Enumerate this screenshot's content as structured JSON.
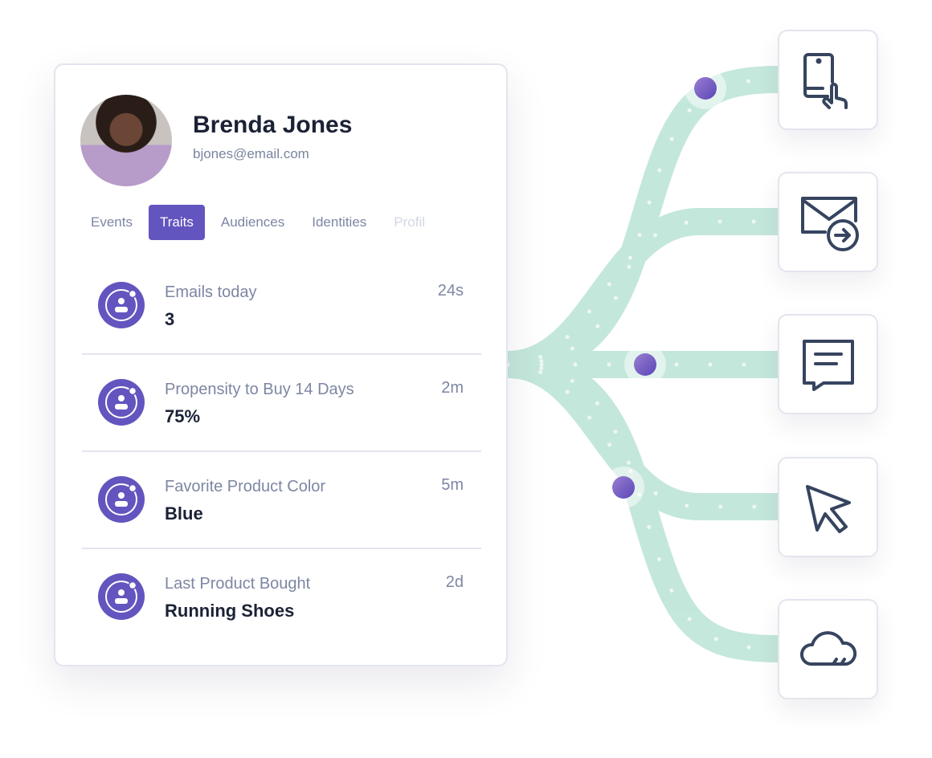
{
  "profile": {
    "name": "Brenda Jones",
    "email": "bjones@email.com"
  },
  "tabs": [
    {
      "label": "Events"
    },
    {
      "label": "Traits",
      "active": true
    },
    {
      "label": "Audiences"
    },
    {
      "label": "Identities"
    },
    {
      "label": "Profile"
    }
  ],
  "traits": [
    {
      "label": "Emails today",
      "value": "3",
      "time": "24s"
    },
    {
      "label": "Propensity to Buy 14 Days",
      "value": "75%",
      "time": "2m"
    },
    {
      "label": "Favorite Product Color",
      "value": "Blue",
      "time": "5m"
    },
    {
      "label": "Last Product Bought",
      "value": "Running Shoes",
      "time": "2d"
    }
  ],
  "destinations": [
    {
      "icon": "mobile-tap-icon"
    },
    {
      "icon": "email-send-icon"
    },
    {
      "icon": "chat-icon"
    },
    {
      "icon": "cursor-icon"
    },
    {
      "icon": "cloud-icon"
    }
  ],
  "colors": {
    "accent": "#6355bf",
    "ribbon": "#bfe6d8",
    "text": "#1b2236",
    "muted": "#7d86a3"
  }
}
